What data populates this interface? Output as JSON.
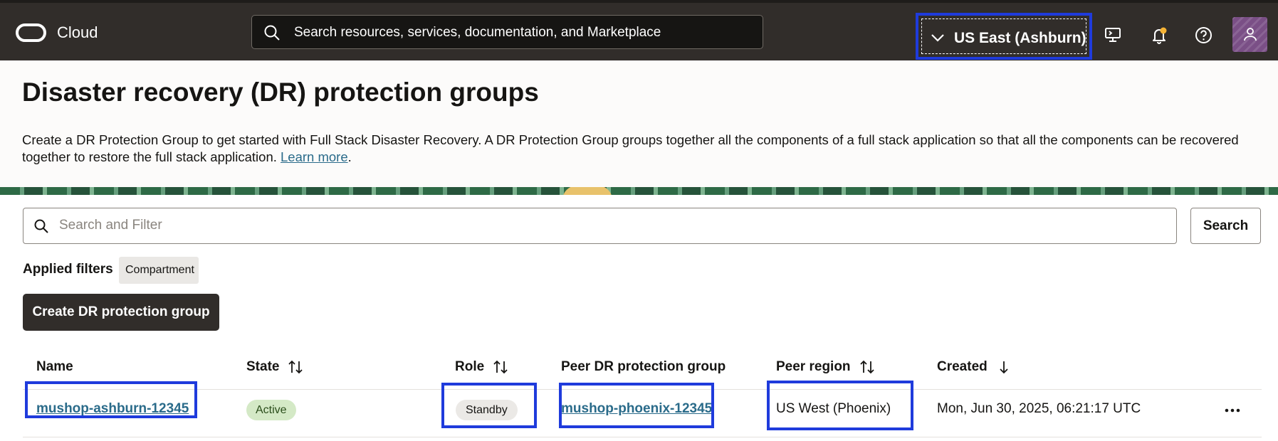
{
  "topbar": {
    "brand": "Cloud",
    "search_placeholder": "Search resources, services, documentation, and Marketplace",
    "region": "US East (Ashburn)",
    "icons": [
      "cloud-shell-icon",
      "bell-icon",
      "help-icon",
      "user-icon"
    ],
    "colors": {
      "bar": "#312d2a",
      "highlight": "#1f3bdc",
      "notification_dot": "#f5b335"
    }
  },
  "page": {
    "title": "Disaster recovery (DR) protection groups",
    "description": "Create a DR Protection Group to get started with Full Stack Disaster Recovery. A DR Protection Group groups together all the components of a full stack application so that all the components can be recovered together to restore the full stack application.",
    "learn_more": "Learn more",
    "period": "."
  },
  "filter": {
    "placeholder": "Search and Filter",
    "search_button": "Search",
    "applied_label": "Applied filters",
    "chips": [
      "Compartment"
    ]
  },
  "actions": {
    "create_button": "Create DR protection group"
  },
  "table": {
    "columns": {
      "name": "Name",
      "state": "State",
      "role": "Role",
      "peer_group": "Peer DR protection group",
      "peer_region": "Peer region",
      "created": "Created"
    },
    "rows": [
      {
        "name": "mushop-ashburn-12345",
        "state": "Active",
        "role": "Standby",
        "peer_group": "mushop-phoenix-12345",
        "peer_region": "US West (Phoenix)",
        "created": "Mon, Jun 30, 2025, 06:21:17 UTC"
      }
    ]
  }
}
